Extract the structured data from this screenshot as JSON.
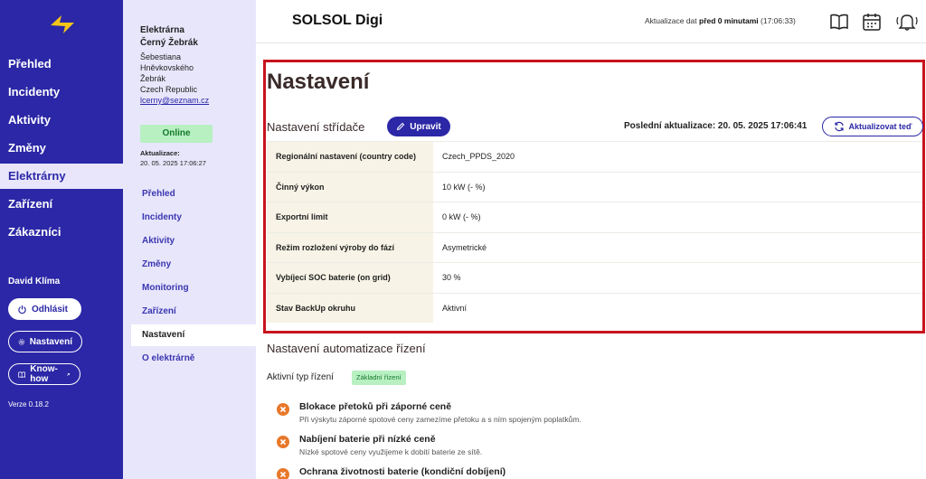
{
  "nav": {
    "items": [
      {
        "label": "Přehled"
      },
      {
        "label": "Incidenty"
      },
      {
        "label": "Aktivity"
      },
      {
        "label": "Změny"
      },
      {
        "label": "Elektrárny"
      },
      {
        "label": "Zařízení"
      },
      {
        "label": "Zákazníci"
      }
    ],
    "active_index": 4,
    "user_name": "David Klíma",
    "logout_label": "Odhlásit",
    "settings_label": "Nastavení",
    "knowhow_label": "Know-how",
    "version": "Verze 0.18.2",
    "brand_color": "#2b27a6",
    "logo_color": "#f5c518"
  },
  "plant": {
    "name_line1": "Elektrárna",
    "name_line2": "Černý Žebrák",
    "addr_line1": "Šebestiana",
    "addr_line2": "Hněvkovského",
    "addr_line3": "Žebrák",
    "addr_line4": "Czech Republic",
    "email": "lcerny@seznam.cz",
    "status": "Online",
    "updated_label": "Aktualizace:",
    "updated_value": "20. 05. 2025 17:06:27",
    "menu": [
      {
        "label": "Přehled"
      },
      {
        "label": "Incidenty"
      },
      {
        "label": "Aktivity"
      },
      {
        "label": "Změny"
      },
      {
        "label": "Monitoring"
      },
      {
        "label": "Zařízení"
      },
      {
        "label": "Nastavení"
      },
      {
        "label": "O elektrárně"
      }
    ],
    "active_menu_index": 6
  },
  "header": {
    "title": "SOLSOL Digi",
    "update_prefix": "Aktualizace dat ",
    "update_bold": "před 0 minutami",
    "update_time": " (17:06:33)"
  },
  "main": {
    "page_title": "Nastavení",
    "inverter_title": "Nastavení střídače",
    "edit_label": "Upravit",
    "last_update": "Poslední aktualizace: 20. 05. 2025 17:06:41",
    "refresh_label": "Aktualizovat teď",
    "rows": [
      {
        "key": "Regionální nastavení (country code)",
        "value": "Czech_PPDS_2020"
      },
      {
        "key": "Činný výkon",
        "value": "10 kW (- %)"
      },
      {
        "key": "Exportní limit",
        "value": "0 kW (- %)"
      },
      {
        "key": "Režim rozložení výroby do fází",
        "value": "Asymetrické"
      },
      {
        "key": "Vybíjecí SOC baterie (on grid)",
        "value": "30 %"
      },
      {
        "key": "Stav BackUp okruhu",
        "value": "Aktivní"
      }
    ],
    "automation_title": "Nastavení automatizace řízení",
    "active_type_label": "Aktivní typ řízení",
    "active_type_badge": "Základní řízení",
    "features": [
      {
        "title": "Blokace přetoků při záporné ceně",
        "desc": "Při výskytu záporné spotové ceny zamezíme přetoku a s ním spojeným poplatkům."
      },
      {
        "title": "Nabíjení baterie při nízké ceně",
        "desc": "Nízké spotové ceny využijeme k dobití baterie ze sítě."
      },
      {
        "title": "Ochrana životnosti baterie (kondiční dobíjení)",
        "desc": ""
      }
    ],
    "highlight_color": "#c8141e",
    "disabled_color": "#e8782a"
  }
}
